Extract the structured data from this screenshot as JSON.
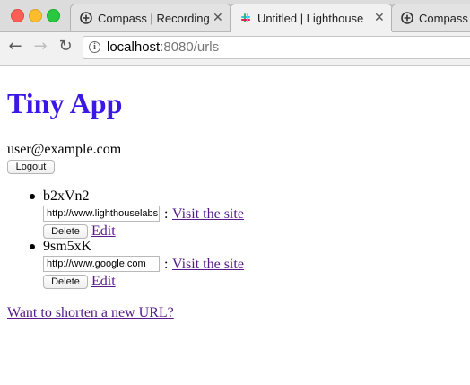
{
  "browser": {
    "tabs": [
      {
        "title": "Compass | Recording",
        "favicon": "compass-icon",
        "active": false
      },
      {
        "title": "Untitled | Lighthouse",
        "favicon": "slack-icon",
        "active": true
      },
      {
        "title": "Compass | Re",
        "favicon": "compass-icon",
        "active": false
      }
    ],
    "tab_close_glyph": "✕",
    "back_glyph": "←",
    "forward_glyph": "→",
    "reload_glyph": "↻",
    "info_glyph": "i",
    "address": {
      "host": "localhost",
      "rest": ":8080/urls"
    }
  },
  "page": {
    "title": "Tiny App",
    "title_color": "#3b17e8",
    "user_email": "user@example.com",
    "logout_label": "Logout",
    "urls": [
      {
        "short_id": "b2xVn2",
        "long_url": "http://www.lighthouselabs.ca",
        "separator": ":",
        "visit_label": "Visit the site",
        "delete_label": "Delete",
        "edit_label": "Edit"
      },
      {
        "short_id": "9sm5xK",
        "long_url": "http://www.google.com",
        "separator": ":",
        "visit_label": "Visit the site",
        "delete_label": "Delete",
        "edit_label": "Edit"
      }
    ],
    "new_url_label": "Want to shorten a new URL?",
    "link_color": "#551a8b"
  }
}
